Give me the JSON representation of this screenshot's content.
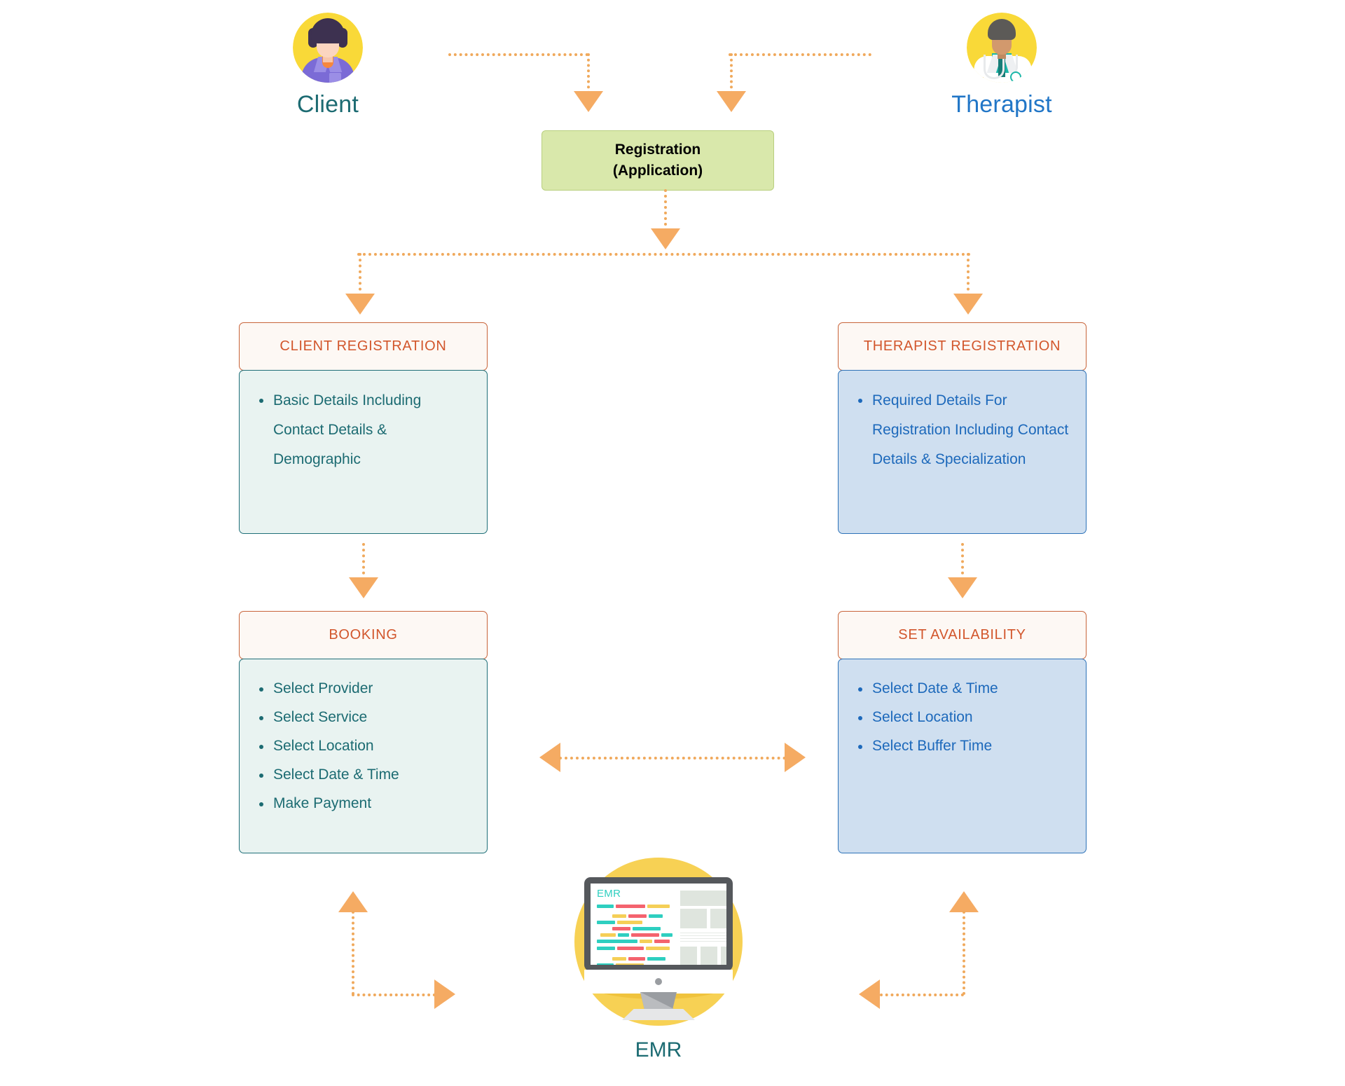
{
  "diagram": {
    "title_visible": false,
    "colors": {
      "arrow": "#f5ab63",
      "dotted_line": "#f0a95c",
      "green_box_fill": "#d9e8ab",
      "green_box_border": "#b9cf7f",
      "header_border": "#c8643a",
      "header_fill": "#fdf8f4",
      "header_text": "#d2562c",
      "teal_text": "#1c6b72",
      "teal_fill": "#e9f3f1",
      "blue_text": "#1d69bb",
      "blue_fill": "#cfdff0",
      "avatar_circle": "#f7d154",
      "emr_accent_teal": "#2ecfc0",
      "emr_accent_red": "#f4636e",
      "emr_accent_yellow": "#f5cf57",
      "client_label": "#1c6b72",
      "therapist_label": "#2176c7"
    },
    "actors": {
      "client": {
        "label": "Client",
        "icon": "client-avatar-icon"
      },
      "therapist": {
        "label": "Therapist",
        "icon": "therapist-avatar-icon"
      }
    },
    "registration_box": {
      "line1": "Registration",
      "line2": "(Application)"
    },
    "left_column": {
      "registration": {
        "header": "CLIENT REGISTRATION",
        "items": [
          "Basic Details Including Contact Details & Demographic"
        ]
      },
      "booking": {
        "header": "BOOKING",
        "items": [
          "Select Provider",
          "Select Service",
          "Select Location",
          "Select Date & Time",
          "Make Payment"
        ]
      }
    },
    "right_column": {
      "registration": {
        "header": "THERAPIST REGISTRATION",
        "items": [
          "Required Details For Registration Including Contact Details & Specialization"
        ]
      },
      "availability": {
        "header": "SET AVAILABILITY",
        "items": [
          "Select Date & Time",
          "Select Location",
          "Select Buffer Time"
        ]
      }
    },
    "emr": {
      "label": "EMR",
      "screen_title": "EMR",
      "icon": "emr-monitor-icon"
    }
  }
}
